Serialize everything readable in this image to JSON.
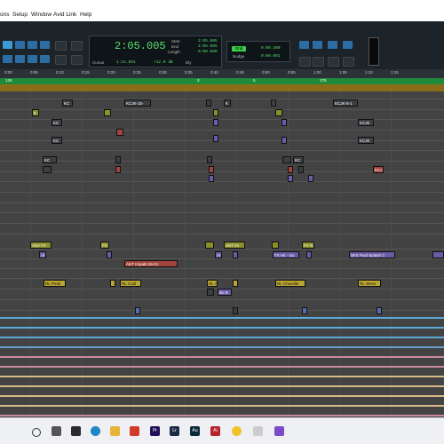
{
  "menu": [
    "ons",
    "Setup",
    "Window",
    "Avid Link",
    "Help"
  ],
  "counter": {
    "main": "2:05.005",
    "cursor_label": "Cursor",
    "cursor_value": "1:24.081",
    "offset_value": "+12.0 dB",
    "dly_label": "Dly",
    "start_label": "Start",
    "end_label": "End",
    "length_label": "Length",
    "start_value": "2:05.005",
    "end_value": "2:05.005",
    "length_value": "0:00.000"
  },
  "nudge": {
    "grid_label": "Grid",
    "grid_value": "0:00.400",
    "nudge_label": "Nudge",
    "nudge_value": "0:00.001"
  },
  "ruler_ticks": [
    "0:00",
    "0:05",
    "0:10",
    "0:15",
    "0:20",
    "0:25",
    "0:30",
    "0:35",
    "0:40",
    "0:45",
    "0:50",
    "0:55",
    "1:00",
    "1:05",
    "1:10",
    "1:15"
  ],
  "markers": [
    "126",
    "3",
    "5",
    "176"
  ],
  "clips": {
    "kc1": "KC",
    "kcjk1": "KCJK-15-",
    "kcjk2": "KCJK-6-1",
    "k1": "K",
    "k2": "K",
    "kc2": "KC",
    "kcjk3": "KCJK",
    "kc3": "KC",
    "kcjk4": "KCJK",
    "kc4": "KC",
    "kc5": "KC",
    "kcj": "KCJ",
    "alv2": "Alv2 FX",
    "fx1": "FX",
    "alvt": "AlvT Im",
    "fxn": "FX N",
    "fxhit": "FX Hit - Gu",
    "sfxpool": "SFX Pool Splash C",
    "alvt_impakt": "AlvT Impakt 26-01",
    "a1": "Al",
    "a2": "Al",
    "peak": "RL Peak",
    "cold": "RL Cold",
    "chevelle": "RL Chevelle",
    "wesn": "RL Wesn",
    "rl_s": "RL S",
    "bo": "Bo B"
  },
  "taskbar_icons": [
    "start",
    "search",
    "task-view",
    "media",
    "edge",
    "explorer",
    "store",
    "premiere",
    "lightroom",
    "audition",
    "illustrator",
    "chrome",
    "photos",
    "protools"
  ],
  "colors": {
    "toolbar": "#1c2329",
    "counter_green": "#56e06b",
    "marker_green": "#1f8b3a",
    "timeline": "#434343"
  }
}
